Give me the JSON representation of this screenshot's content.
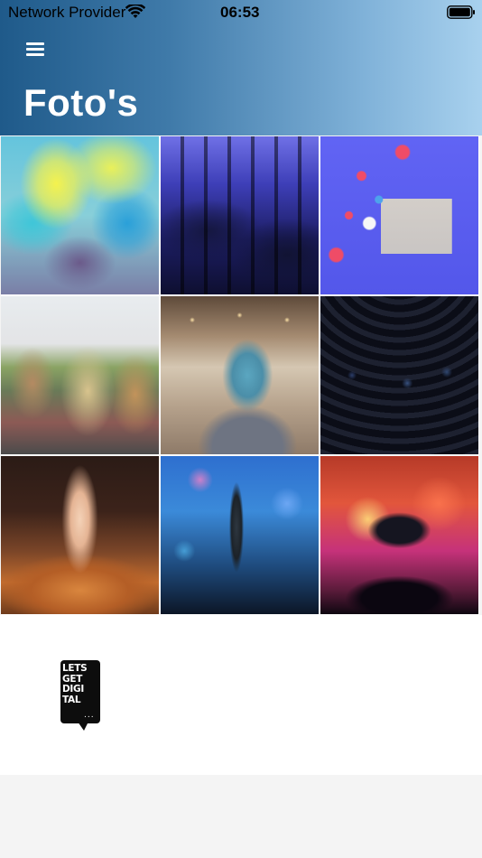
{
  "status_bar": {
    "carrier": "Network Provider",
    "time": "06:53",
    "wifi_icon": "wifi-icon",
    "battery_icon": "battery-icon"
  },
  "header": {
    "menu_icon": "hamburger-menu-icon",
    "title": "Foto's",
    "gradient_colors": [
      "#1f5a8a",
      "#a8d1ee"
    ]
  },
  "gallery": {
    "photos": [
      {
        "subject": "color powder festival"
      },
      {
        "subject": "conference chairs"
      },
      {
        "subject": "social media likes"
      },
      {
        "subject": "outdoor festival crowd"
      },
      {
        "subject": "woman in conference hall"
      },
      {
        "subject": "audience in dark hall"
      },
      {
        "subject": "concert hands raised"
      },
      {
        "subject": "stage microphone"
      },
      {
        "subject": "concert phone recording"
      }
    ]
  },
  "footer": {
    "logo_lines": [
      "LETS",
      "GET",
      "DIGI",
      "TAL"
    ],
    "logo_dots": "..."
  }
}
